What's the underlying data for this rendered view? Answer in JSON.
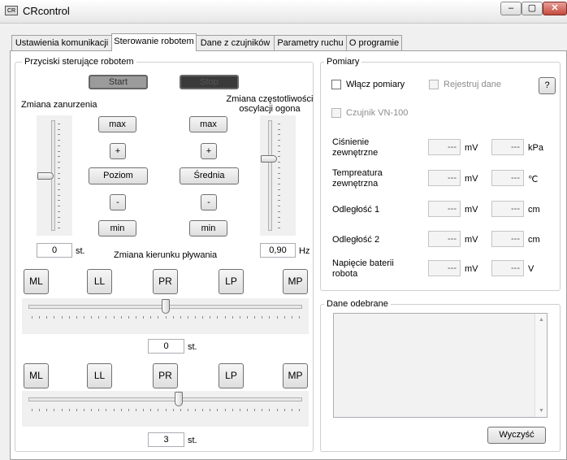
{
  "window": {
    "title": "CRcontrol",
    "icon_label": "CR",
    "minimize": "–",
    "maximize": "▢",
    "close": "✕"
  },
  "tabs": [
    {
      "label": "Ustawienia komunikacji",
      "active": false
    },
    {
      "label": "Sterowanie robotem",
      "active": true
    },
    {
      "label": "Dane z czujników",
      "active": false
    },
    {
      "label": "Parametry ruchu",
      "active": false
    },
    {
      "label": "O programie",
      "active": false
    }
  ],
  "control": {
    "group_title": "Przyciski sterujące robotem",
    "start_label": "Start",
    "stop_label": "Stop",
    "depth": {
      "title": "Zmiana zanurzenia",
      "max_label": "max",
      "plus_label": "+",
      "center_label": "Poziom",
      "minus_label": "-",
      "min_label": "min",
      "value": "0",
      "unit": "st.",
      "slider_fraction": 0.5
    },
    "tail": {
      "title": "Zmiana częstotliwości oscylacji ogona",
      "max_label": "max",
      "plus_label": "+",
      "center_label": "Średnia",
      "minus_label": "-",
      "min_label": "min",
      "value": "0,90",
      "unit": "Hz",
      "slider_fraction": 0.66
    },
    "direction": {
      "title": "Zmiana kierunku pływania",
      "buttons1": [
        "ML",
        "LL",
        "PR",
        "LP",
        "MP"
      ],
      "value1": "0",
      "unit1": "st.",
      "slider1_fraction": 0.5,
      "buttons2": [
        "ML",
        "LL",
        "PR",
        "LP",
        "MP"
      ],
      "value2": "3",
      "unit2": "st.",
      "slider2_fraction": 0.55
    }
  },
  "measurements": {
    "group_title": "Pomiary",
    "enable_label": "Włącz pomiary",
    "record_label": "Rejestruj dane",
    "help_label": "?",
    "sensor_label": "Czujnik VN-100",
    "rows": [
      {
        "label": "Ciśnienie zewnętrzne",
        "val1": "---",
        "unit1": "mV",
        "val2": "---",
        "unit2": "kPa"
      },
      {
        "label": "Tempreatura zewnętrzna",
        "val1": "---",
        "unit1": "mV",
        "val2": "---",
        "unit2": "℃"
      },
      {
        "label": "Odległość 1",
        "val1": "---",
        "unit1": "mV",
        "val2": "---",
        "unit2": "cm"
      },
      {
        "label": "Odległość 2",
        "val1": "---",
        "unit1": "mV",
        "val2": "---",
        "unit2": "cm"
      },
      {
        "label": "Napięcie baterii robota",
        "val1": "---",
        "unit1": "mV",
        "val2": "---",
        "unit2": "V"
      }
    ]
  },
  "received": {
    "group_title": "Dane odebrane",
    "content": "",
    "clear_label": "Wyczyść"
  }
}
